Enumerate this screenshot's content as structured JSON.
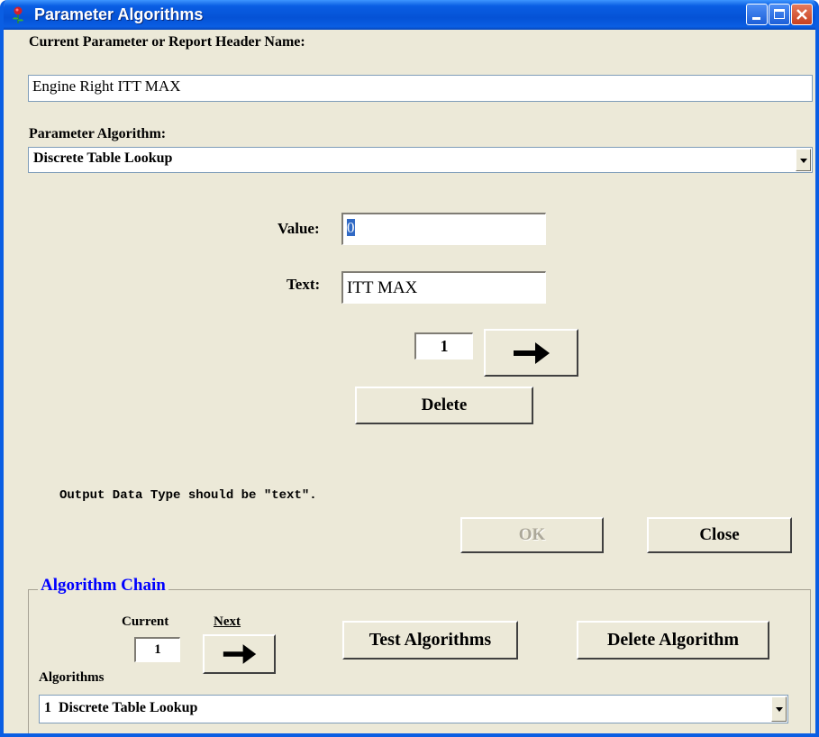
{
  "window": {
    "title": "Parameter Algorithms"
  },
  "param": {
    "name_label": "Current Parameter or Report Header Name:",
    "name_value": "Engine Right ITT MAX",
    "algo_label": "Parameter Algorithm:",
    "algo_value": "Discrete Table Lookup"
  },
  "lookup": {
    "value_label": "Value:",
    "value": "0",
    "text_label": "Text:",
    "text": "ITT MAX",
    "index": "1",
    "delete_label": "Delete"
  },
  "note": "Output Data Type should be \"text\".",
  "actions": {
    "ok_label": "OK",
    "close_label": "Close"
  },
  "chain": {
    "title": "Algorithm Chain",
    "current_label": "Current",
    "next_label": "Next",
    "current_value": "1",
    "test_label": "Test Algorithms",
    "delete_algo_label": "Delete Algorithm",
    "algorithms_label": "Algorithms",
    "selected_algorithm": "1  Discrete Table Lookup"
  },
  "icons": {
    "app": "rose-icon",
    "next": "right-arrow-icon"
  }
}
